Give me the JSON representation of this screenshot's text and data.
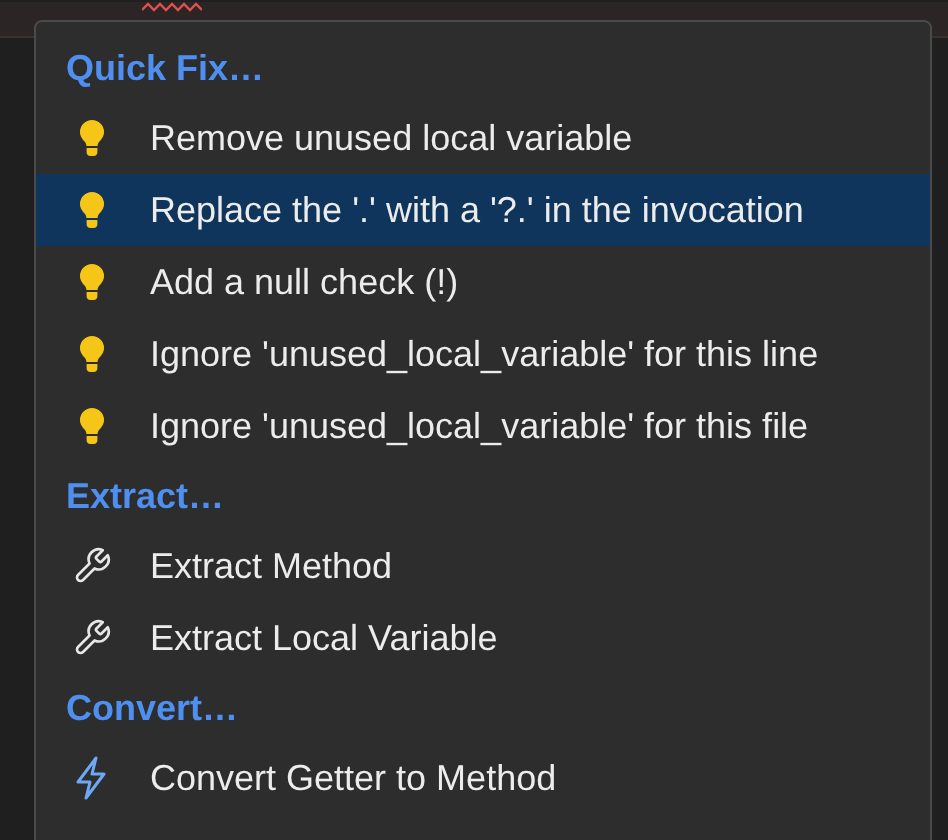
{
  "sections": [
    {
      "heading": "Quick Fix…",
      "items": [
        {
          "kind": "bulb",
          "label": "Remove unused local variable",
          "selected": false
        },
        {
          "kind": "bulb",
          "label": "Replace the '.' with a '?.' in the invocation",
          "selected": true
        },
        {
          "kind": "bulb",
          "label": "Add a null check (!)",
          "selected": false
        },
        {
          "kind": "bulb",
          "label": "Ignore 'unused_local_variable' for this line",
          "selected": false
        },
        {
          "kind": "bulb",
          "label": "Ignore 'unused_local_variable' for this file",
          "selected": false
        }
      ]
    },
    {
      "heading": "Extract…",
      "items": [
        {
          "kind": "wrench",
          "label": "Extract Method",
          "selected": false
        },
        {
          "kind": "wrench",
          "label": "Extract Local Variable",
          "selected": false
        }
      ]
    },
    {
      "heading": "Convert…",
      "items": [
        {
          "kind": "bolt",
          "label": "Convert Getter to Method",
          "selected": false
        }
      ]
    }
  ]
}
